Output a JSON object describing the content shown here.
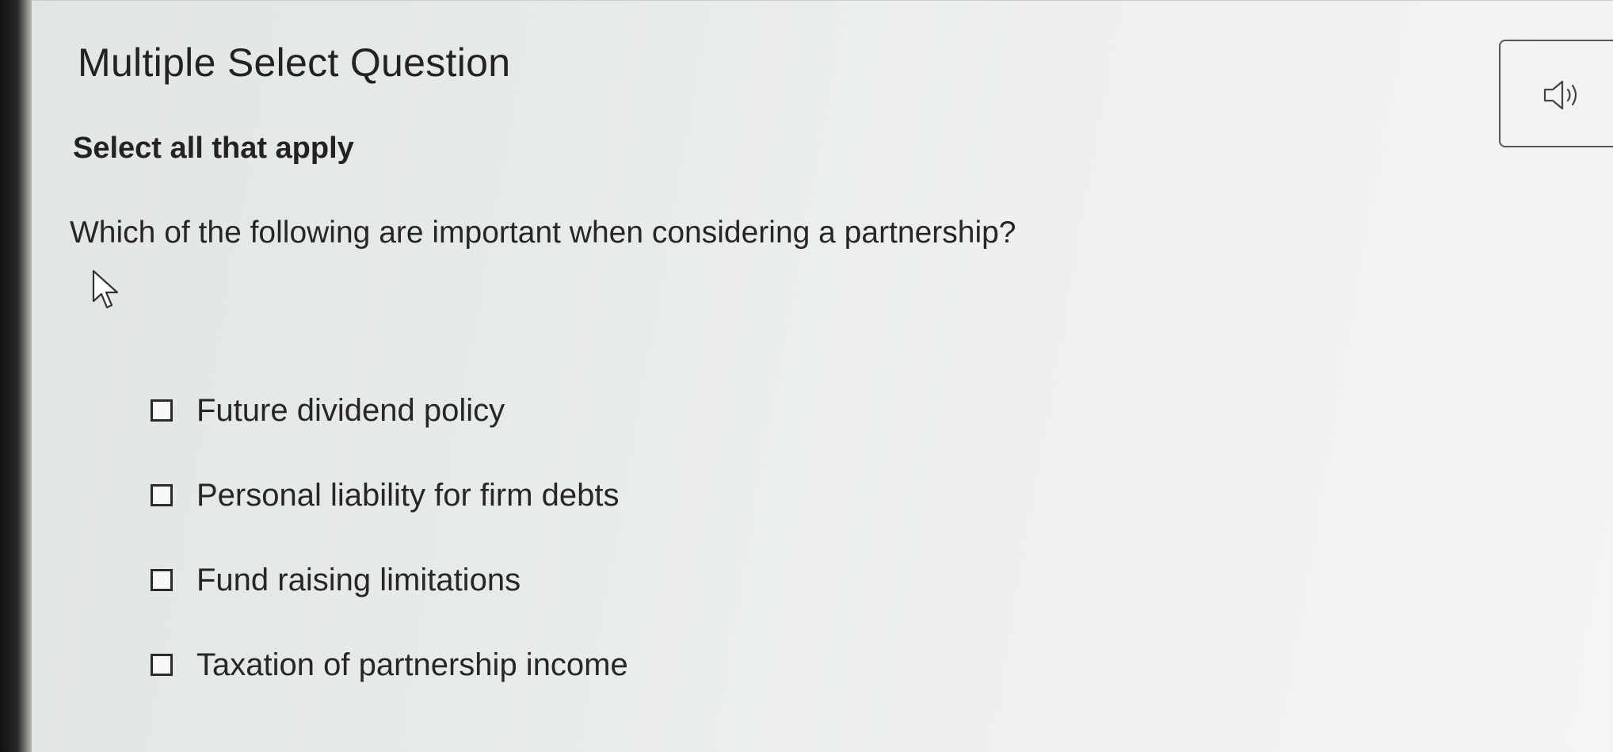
{
  "header": {
    "title": "Multiple Select Question"
  },
  "prompt": {
    "instruction": "Select all that apply",
    "question": "Which of the following are important when considering a partnership?"
  },
  "options": [
    {
      "label": "Future dividend policy",
      "checked": false
    },
    {
      "label": "Personal liability for firm debts",
      "checked": false
    },
    {
      "label": "Fund raising limitations",
      "checked": false
    },
    {
      "label": "Taxation of partnership income",
      "checked": false
    }
  ],
  "icons": {
    "audio": "speaker-icon",
    "cursor": "mouse-pointer-icon"
  }
}
